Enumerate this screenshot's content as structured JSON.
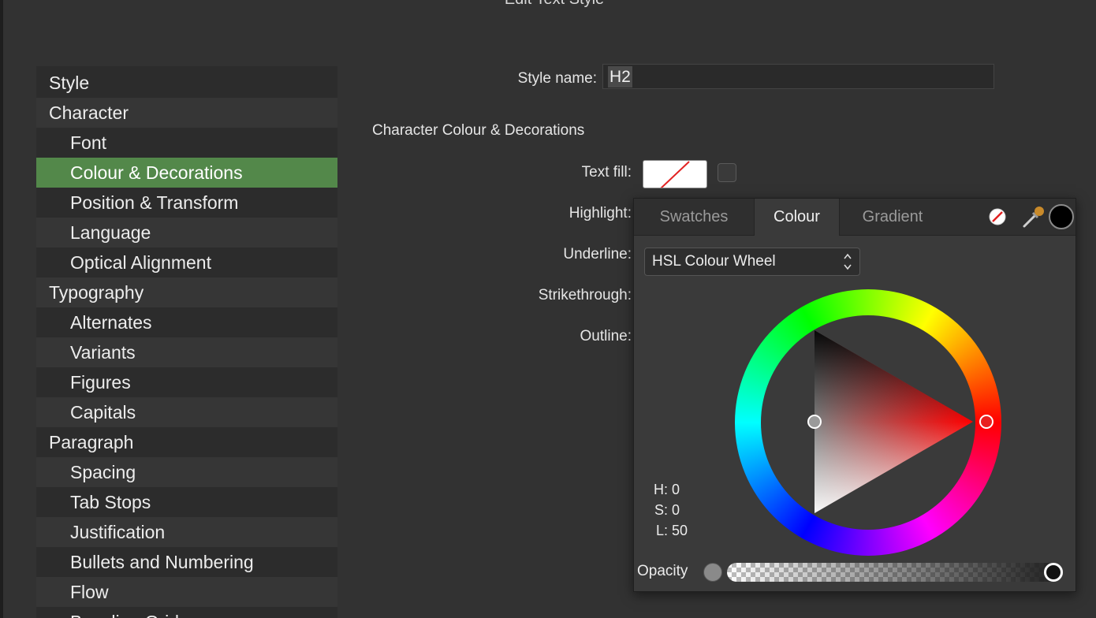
{
  "dialog": {
    "title": "Edit Text Style"
  },
  "sidebar": {
    "items": [
      {
        "label": "Style",
        "level": "top"
      },
      {
        "label": "Character",
        "level": "top"
      },
      {
        "label": "Font",
        "level": "sub"
      },
      {
        "label": "Colour & Decorations",
        "level": "sub",
        "selected": true
      },
      {
        "label": "Position & Transform",
        "level": "sub"
      },
      {
        "label": "Language",
        "level": "sub"
      },
      {
        "label": "Optical Alignment",
        "level": "sub"
      },
      {
        "label": "Typography",
        "level": "top"
      },
      {
        "label": "Alternates",
        "level": "sub"
      },
      {
        "label": "Variants",
        "level": "sub"
      },
      {
        "label": "Figures",
        "level": "sub"
      },
      {
        "label": "Capitals",
        "level": "sub"
      },
      {
        "label": "Paragraph",
        "level": "top"
      },
      {
        "label": "Spacing",
        "level": "sub"
      },
      {
        "label": "Tab Stops",
        "level": "sub"
      },
      {
        "label": "Justification",
        "level": "sub"
      },
      {
        "label": "Bullets and Numbering",
        "level": "sub"
      },
      {
        "label": "Flow",
        "level": "sub"
      },
      {
        "label": "Baseline Grid",
        "level": "sub"
      }
    ],
    "selected_color": "#53884a"
  },
  "form": {
    "style_name_label": "Style name:",
    "style_name_value": "H2",
    "section_heading": "Character Colour & Decorations",
    "text_fill_label": "Text fill:",
    "highlight_label": "Highlight:",
    "underline_label": "Underline:",
    "strikethrough_label": "Strikethrough:",
    "outline_label": "Outline:"
  },
  "colour_panel": {
    "tabs": [
      {
        "label": "Swatches",
        "active": false
      },
      {
        "label": "Colour",
        "active": true
      },
      {
        "label": "Gradient",
        "active": false
      }
    ],
    "icons": [
      "no-fill-icon",
      "eyedropper-icon",
      "current-colour-icon"
    ],
    "model": "HSL Colour Wheel",
    "hsl": {
      "h": "0",
      "s": "0",
      "l": "50"
    },
    "hsl_labels": {
      "h": "H:",
      "s": "S:",
      "l": "L:"
    },
    "opacity_label": "Opacity",
    "opacity_value": 1.0
  }
}
